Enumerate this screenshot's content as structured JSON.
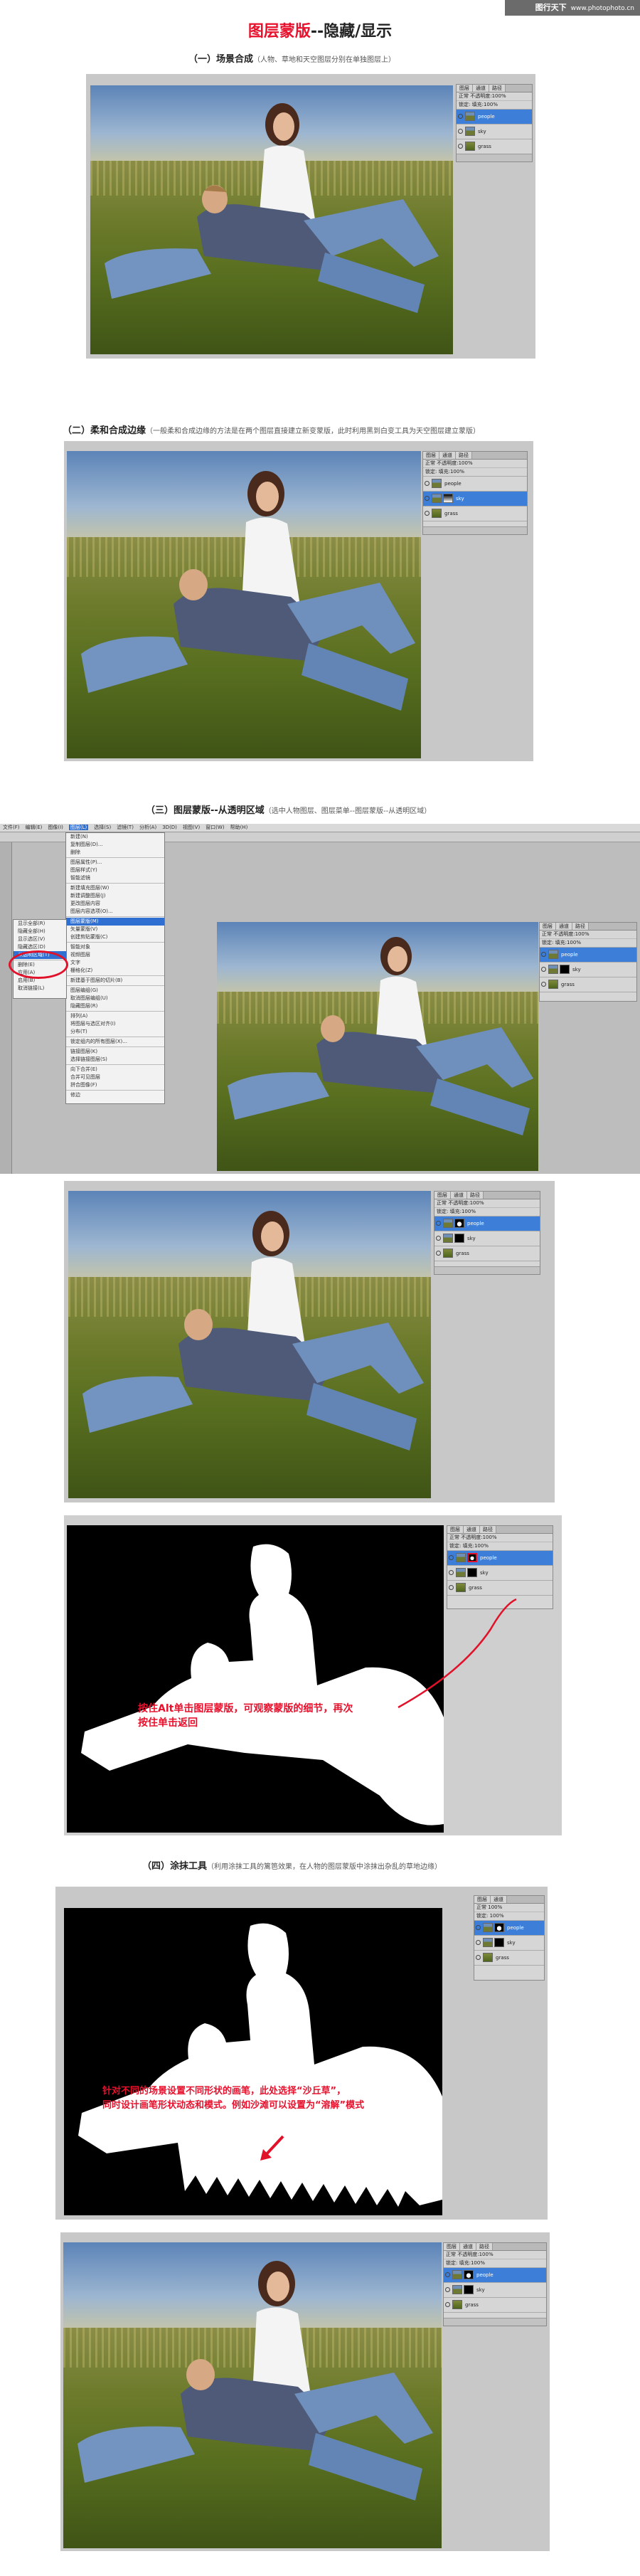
{
  "watermark": {
    "brand": "图行天下",
    "url": "www.photophoto.cn"
  },
  "header": {
    "title_red": "图层蒙版",
    "title_dark": "--隐藏/显示"
  },
  "sections": [
    {
      "title": "（一）场景合成",
      "note": "（人物、草地和天空图层分别在单独图层上）"
    },
    {
      "title": "（二）柔和合成边缘",
      "note": "（一般柔和合成边缘的方法是在两个图层直接建立新变蒙版，此时利用黑到白变工具为天空图层建立蒙版）"
    },
    {
      "title": "（三）图层蒙版--从透明区域",
      "note": "（选中人物图层、图层菜单--图层蒙版--从透明区域）"
    },
    {
      "title": "（四）涂抹工具",
      "note": "（利用涂抹工具的篱笆效果，在人物的图层蒙版中涂抹出杂乱的草地边缘）"
    }
  ],
  "panel": {
    "tabs": [
      "图层",
      "通道",
      "路径"
    ],
    "blend_mode": "正常",
    "opacity_label": "不透明度:",
    "opacity_value": "100%",
    "lock_label": "锁定:",
    "fill_label": "填充:",
    "fill_value": "100%",
    "layers": [
      "people",
      "sky",
      "grass"
    ]
  },
  "ps_menu": {
    "menubar": [
      "文件(F)",
      "编辑(E)",
      "图像(I)",
      "图层(L)",
      "选择(S)",
      "滤镜(T)",
      "分析(A)",
      "3D(D)",
      "视图(V)",
      "窗口(W)",
      "帮助(H)"
    ],
    "layer_menu": [
      "新建(N)",
      "复制图层(D)...",
      "删除",
      "图层属性(P)...",
      "图层样式(Y)",
      "智能滤镜",
      "新建填充图层(W)",
      "新建调整图层(J)",
      "更改图层内容",
      "图层内容选项(O)...",
      "图层蒙版(M)",
      "矢量蒙版(V)",
      "创建剪贴蒙版(C)",
      "智能对象",
      "视频图层",
      "文字",
      "栅格化(Z)",
      "新建基于图层的切片(B)",
      "图层编组(G)",
      "取消图层编组(U)",
      "隐藏图层(R)",
      "排列(A)",
      "将图层与选区对齐(I)",
      "分布(T)",
      "锁定组内的所有图层(X)...",
      "链接图层(K)",
      "选择链接图层(S)",
      "向下合并(E)",
      "合并可见图层",
      "拼合图像(F)",
      "修边"
    ],
    "mask_submenu": [
      "显示全部(R)",
      "隐藏全部(H)",
      "显示选区(V)",
      "隐藏选区(D)",
      "从透明区域(T)",
      "删除(E)",
      "应用(A)",
      "启用(B)",
      "取消链接(L)"
    ],
    "highlighted": "从透明区域(T)"
  },
  "annotations": {
    "alt_click": [
      "按住Alt单击图层蒙版，可观察蒙版的细节，再次",
      "按住单击返回"
    ],
    "brush_tip": [
      "针对不同的场景设置不同形状的画笔，此处选择“沙丘草”，",
      "同时设计画笔形状动态和模式。例如沙滩可以设置为“溶解”模式"
    ]
  },
  "colors": {
    "accent": "#e8112d",
    "selected_layer": "#3d7fd8",
    "ps_gray": "#c8c8c8"
  }
}
